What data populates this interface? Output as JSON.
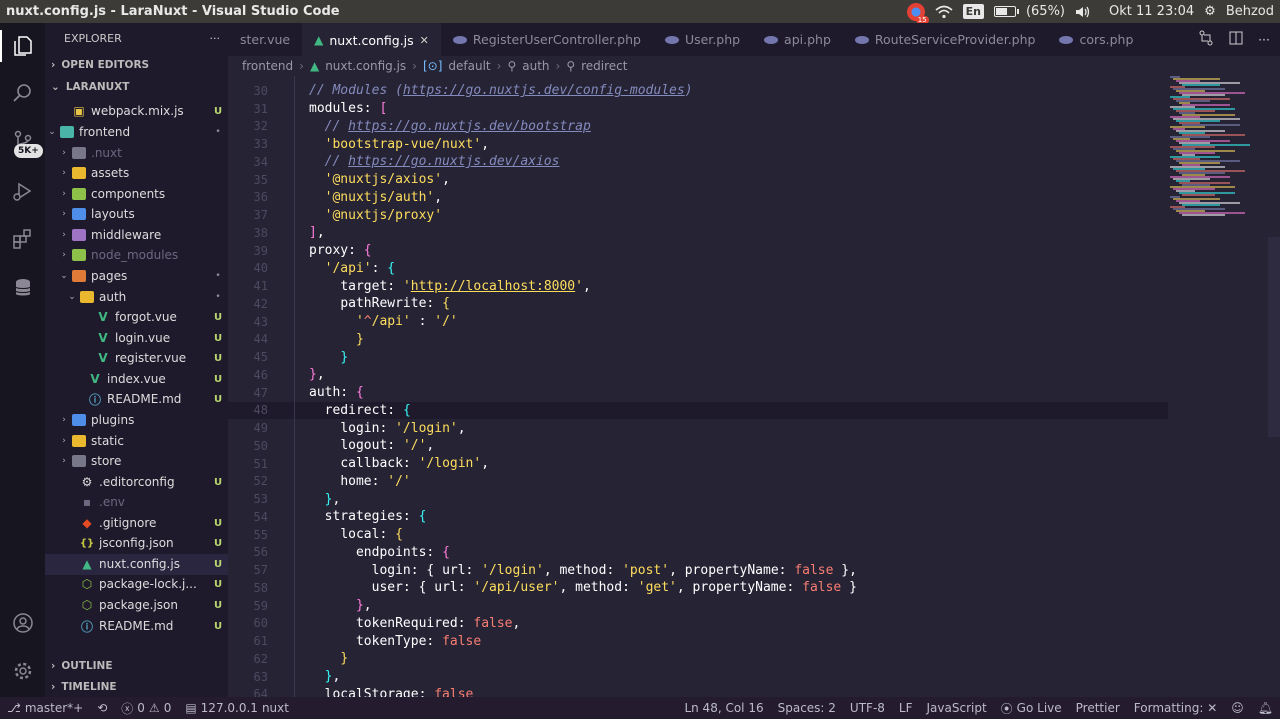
{
  "os": {
    "window_title": "nuxt.config.js - LaraNuxt - Visual Studio Code",
    "keyboard_layout": "En",
    "battery": "(65%)",
    "battery_level": 0.65,
    "datetime": "Okt 11 23:04",
    "user": "Behzod",
    "chrome_badge": "15"
  },
  "activity": {
    "extensions_badge": "5K+"
  },
  "sidebar": {
    "title": "EXPLORER",
    "more": "···",
    "open_editors": "OPEN EDITORS",
    "workspace": "LARANUXT",
    "outline": "OUTLINE",
    "timeline": "TIMELINE",
    "tree": [
      {
        "label": "webpack.mix.js",
        "status": "U",
        "dim": false
      },
      {
        "label": "frontend",
        "status": "•",
        "dim": false
      },
      {
        "label": ".nuxt",
        "status": "",
        "dim": true
      },
      {
        "label": "assets",
        "status": "",
        "dim": false
      },
      {
        "label": "components",
        "status": "",
        "dim": false
      },
      {
        "label": "layouts",
        "status": "",
        "dim": false
      },
      {
        "label": "middleware",
        "status": "",
        "dim": false
      },
      {
        "label": "node_modules",
        "status": "",
        "dim": true
      },
      {
        "label": "pages",
        "status": "•",
        "dim": false
      },
      {
        "label": "auth",
        "status": "•",
        "dim": false
      },
      {
        "label": "forgot.vue",
        "status": "U",
        "dim": false
      },
      {
        "label": "login.vue",
        "status": "U",
        "dim": false
      },
      {
        "label": "register.vue",
        "status": "U",
        "dim": false
      },
      {
        "label": "index.vue",
        "status": "U",
        "dim": false
      },
      {
        "label": "README.md",
        "status": "U",
        "dim": false
      },
      {
        "label": "plugins",
        "status": "",
        "dim": false
      },
      {
        "label": "static",
        "status": "",
        "dim": false
      },
      {
        "label": "store",
        "status": "",
        "dim": false
      },
      {
        "label": ".editorconfig",
        "status": "U",
        "dim": false
      },
      {
        "label": ".env",
        "status": "",
        "dim": true
      },
      {
        "label": ".gitignore",
        "status": "U",
        "dim": false
      },
      {
        "label": "jsconfig.json",
        "status": "U",
        "dim": false
      },
      {
        "label": "nuxt.config.js",
        "status": "U",
        "dim": false
      },
      {
        "label": "package-lock.j...",
        "status": "U",
        "dim": false
      },
      {
        "label": "package.json",
        "status": "U",
        "dim": false
      },
      {
        "label": "README.md",
        "status": "U",
        "dim": false
      }
    ]
  },
  "tabs": [
    {
      "label": "ster.vue"
    },
    {
      "label": "nuxt.config.js",
      "close": "✕"
    },
    {
      "label": "RegisterUserController.php"
    },
    {
      "label": "User.php"
    },
    {
      "label": "api.php"
    },
    {
      "label": "RouteServiceProvider.php"
    },
    {
      "label": "cors.php"
    }
  ],
  "breadcrumbs": [
    "frontend",
    "nuxt.config.js",
    "default",
    "auth",
    "redirect"
  ],
  "editor": {
    "line_numbers": [
      "30",
      "31",
      "32",
      "33",
      "34",
      "35",
      "36",
      "37",
      "38",
      "39",
      "40",
      "41",
      "42",
      "43",
      "44",
      "45",
      "46",
      "47",
      "48",
      "49",
      "50",
      "51",
      "52",
      "53",
      "54",
      "55",
      "56",
      "57",
      "58",
      "59",
      "60",
      "61",
      "62",
      "63",
      "64"
    ],
    "current_line": "48"
  },
  "statusbar": {
    "branch": "master*+",
    "errors": "0",
    "warnings": "0",
    "server": "127.0.0.1",
    "server_name": "nuxt",
    "position": "Ln 48, Col 16",
    "spaces": "Spaces: 2",
    "encoding": "UTF-8",
    "eol": "LF",
    "language": "JavaScript",
    "golive": "Go Live",
    "prettier": "Prettier",
    "formatting": "Formatting: ✕"
  }
}
